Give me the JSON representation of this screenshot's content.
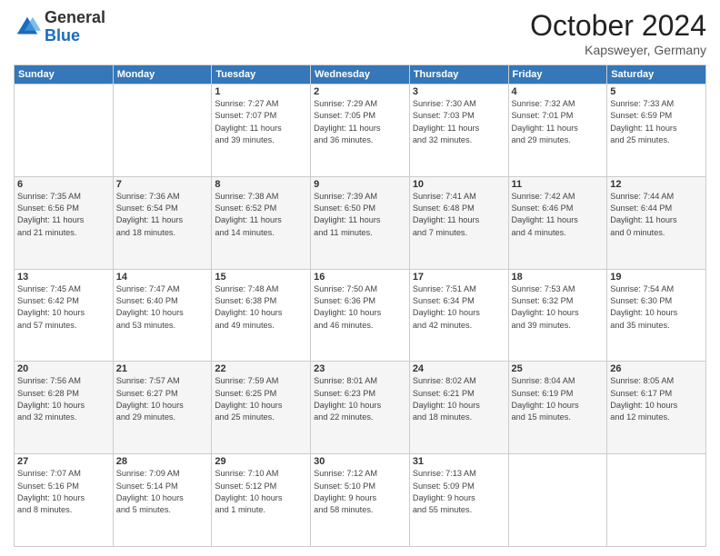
{
  "header": {
    "logo_general": "General",
    "logo_blue": "Blue",
    "month": "October 2024",
    "location": "Kapsweyer, Germany"
  },
  "days_of_week": [
    "Sunday",
    "Monday",
    "Tuesday",
    "Wednesday",
    "Thursday",
    "Friday",
    "Saturday"
  ],
  "weeks": [
    [
      {
        "day": "",
        "detail": ""
      },
      {
        "day": "",
        "detail": ""
      },
      {
        "day": "1",
        "detail": "Sunrise: 7:27 AM\nSunset: 7:07 PM\nDaylight: 11 hours\nand 39 minutes."
      },
      {
        "day": "2",
        "detail": "Sunrise: 7:29 AM\nSunset: 7:05 PM\nDaylight: 11 hours\nand 36 minutes."
      },
      {
        "day": "3",
        "detail": "Sunrise: 7:30 AM\nSunset: 7:03 PM\nDaylight: 11 hours\nand 32 minutes."
      },
      {
        "day": "4",
        "detail": "Sunrise: 7:32 AM\nSunset: 7:01 PM\nDaylight: 11 hours\nand 29 minutes."
      },
      {
        "day": "5",
        "detail": "Sunrise: 7:33 AM\nSunset: 6:59 PM\nDaylight: 11 hours\nand 25 minutes."
      }
    ],
    [
      {
        "day": "6",
        "detail": "Sunrise: 7:35 AM\nSunset: 6:56 PM\nDaylight: 11 hours\nand 21 minutes."
      },
      {
        "day": "7",
        "detail": "Sunrise: 7:36 AM\nSunset: 6:54 PM\nDaylight: 11 hours\nand 18 minutes."
      },
      {
        "day": "8",
        "detail": "Sunrise: 7:38 AM\nSunset: 6:52 PM\nDaylight: 11 hours\nand 14 minutes."
      },
      {
        "day": "9",
        "detail": "Sunrise: 7:39 AM\nSunset: 6:50 PM\nDaylight: 11 hours\nand 11 minutes."
      },
      {
        "day": "10",
        "detail": "Sunrise: 7:41 AM\nSunset: 6:48 PM\nDaylight: 11 hours\nand 7 minutes."
      },
      {
        "day": "11",
        "detail": "Sunrise: 7:42 AM\nSunset: 6:46 PM\nDaylight: 11 hours\nand 4 minutes."
      },
      {
        "day": "12",
        "detail": "Sunrise: 7:44 AM\nSunset: 6:44 PM\nDaylight: 11 hours\nand 0 minutes."
      }
    ],
    [
      {
        "day": "13",
        "detail": "Sunrise: 7:45 AM\nSunset: 6:42 PM\nDaylight: 10 hours\nand 57 minutes."
      },
      {
        "day": "14",
        "detail": "Sunrise: 7:47 AM\nSunset: 6:40 PM\nDaylight: 10 hours\nand 53 minutes."
      },
      {
        "day": "15",
        "detail": "Sunrise: 7:48 AM\nSunset: 6:38 PM\nDaylight: 10 hours\nand 49 minutes."
      },
      {
        "day": "16",
        "detail": "Sunrise: 7:50 AM\nSunset: 6:36 PM\nDaylight: 10 hours\nand 46 minutes."
      },
      {
        "day": "17",
        "detail": "Sunrise: 7:51 AM\nSunset: 6:34 PM\nDaylight: 10 hours\nand 42 minutes."
      },
      {
        "day": "18",
        "detail": "Sunrise: 7:53 AM\nSunset: 6:32 PM\nDaylight: 10 hours\nand 39 minutes."
      },
      {
        "day": "19",
        "detail": "Sunrise: 7:54 AM\nSunset: 6:30 PM\nDaylight: 10 hours\nand 35 minutes."
      }
    ],
    [
      {
        "day": "20",
        "detail": "Sunrise: 7:56 AM\nSunset: 6:28 PM\nDaylight: 10 hours\nand 32 minutes."
      },
      {
        "day": "21",
        "detail": "Sunrise: 7:57 AM\nSunset: 6:27 PM\nDaylight: 10 hours\nand 29 minutes."
      },
      {
        "day": "22",
        "detail": "Sunrise: 7:59 AM\nSunset: 6:25 PM\nDaylight: 10 hours\nand 25 minutes."
      },
      {
        "day": "23",
        "detail": "Sunrise: 8:01 AM\nSunset: 6:23 PM\nDaylight: 10 hours\nand 22 minutes."
      },
      {
        "day": "24",
        "detail": "Sunrise: 8:02 AM\nSunset: 6:21 PM\nDaylight: 10 hours\nand 18 minutes."
      },
      {
        "day": "25",
        "detail": "Sunrise: 8:04 AM\nSunset: 6:19 PM\nDaylight: 10 hours\nand 15 minutes."
      },
      {
        "day": "26",
        "detail": "Sunrise: 8:05 AM\nSunset: 6:17 PM\nDaylight: 10 hours\nand 12 minutes."
      }
    ],
    [
      {
        "day": "27",
        "detail": "Sunrise: 7:07 AM\nSunset: 5:16 PM\nDaylight: 10 hours\nand 8 minutes."
      },
      {
        "day": "28",
        "detail": "Sunrise: 7:09 AM\nSunset: 5:14 PM\nDaylight: 10 hours\nand 5 minutes."
      },
      {
        "day": "29",
        "detail": "Sunrise: 7:10 AM\nSunset: 5:12 PM\nDaylight: 10 hours\nand 1 minute."
      },
      {
        "day": "30",
        "detail": "Sunrise: 7:12 AM\nSunset: 5:10 PM\nDaylight: 9 hours\nand 58 minutes."
      },
      {
        "day": "31",
        "detail": "Sunrise: 7:13 AM\nSunset: 5:09 PM\nDaylight: 9 hours\nand 55 minutes."
      },
      {
        "day": "",
        "detail": ""
      },
      {
        "day": "",
        "detail": ""
      }
    ]
  ]
}
